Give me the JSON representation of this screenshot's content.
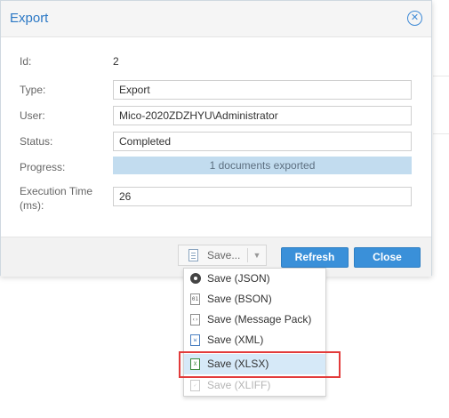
{
  "dialog": {
    "title": "Export",
    "fields": {
      "id_label": "Id:",
      "id_value": "2",
      "type_label": "Type:",
      "type_value": "Export",
      "user_label": "User:",
      "user_value": "Mico-2020ZDZHYU\\Administrator",
      "status_label": "Status:",
      "status_value": "Completed",
      "progress_label": "Progress:",
      "progress_text": "1 documents exported",
      "progress_fraction": 1.0,
      "exec_label_line1": "Execution Time",
      "exec_label_line2": "(ms):",
      "exec_value": "26"
    },
    "footer": {
      "save_label": "Save...",
      "refresh_label": "Refresh",
      "close_label": "Close"
    }
  },
  "save_menu": {
    "items": [
      {
        "label": "Save (JSON)",
        "icon": "json-icon"
      },
      {
        "label": "Save (BSON)",
        "icon": "bson-icon"
      },
      {
        "label": "Save (Message Pack)",
        "icon": "msgpack-icon"
      },
      {
        "label": "Save (XML)",
        "icon": "xml-icon"
      },
      {
        "label": "Save (XLSX)",
        "icon": "xlsx-icon"
      },
      {
        "label": "Save (XLIFF)",
        "icon": "xliff-icon"
      }
    ]
  },
  "colors": {
    "accent": "#3a90d9",
    "title": "#2b78c5",
    "progress": "#c2dcef",
    "highlight": "#e23b3b",
    "selected": "#d6e9f8"
  }
}
